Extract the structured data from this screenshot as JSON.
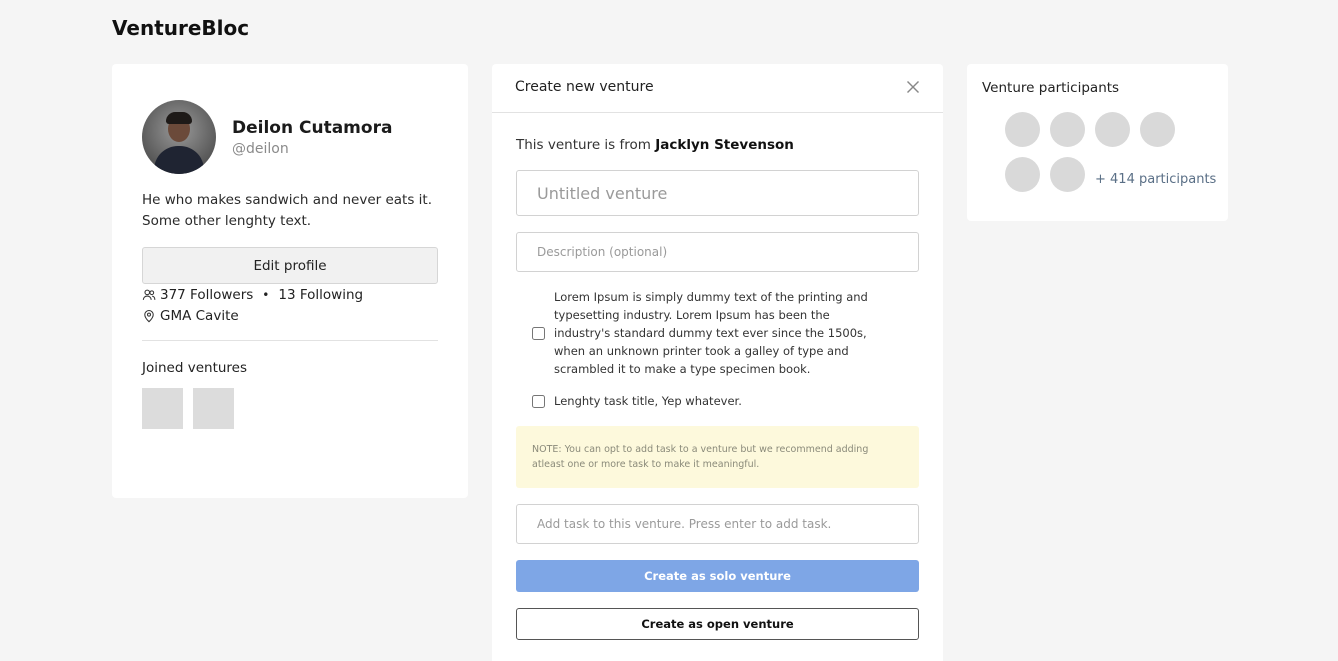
{
  "app": {
    "brand": "VentureBloc"
  },
  "profile": {
    "name": "Deilon Cutamora",
    "handle": "@deilon",
    "bio": "He who makes sandwich and never eats it. Some other lenghty text.",
    "edit_label": "Edit profile",
    "followers": "377 Followers",
    "separator": "•",
    "following": "13 Following",
    "location": "GMA Cavite",
    "joined_title": "Joined ventures",
    "joined_count": 2
  },
  "create": {
    "title": "Create new venture",
    "from_prefix": "This venture is from",
    "from_name": "Jacklyn Stevenson",
    "title_placeholder": "Untitled venture",
    "description_placeholder": "Description (optional)",
    "tasks": [
      {
        "label": "Lorem Ipsum is simply dummy text of the printing and typesetting industry. Lorem Ipsum has been the industry's standard dummy text ever since the 1500s, when an unknown printer took a galley of type and scrambled it to make a type specimen book.",
        "checked": false
      },
      {
        "label": "Lenghty task title, Yep whatever.",
        "checked": false
      }
    ],
    "note": "NOTE: You can opt to add task to a venture but we recommend adding atleast one or more task to make it meaningful.",
    "task_placeholder": "Add task to this venture. Press enter to add task.",
    "solo_label": "Create as solo venture",
    "open_label": "Create as open venture",
    "colors": {
      "solo_button": "#7ea6e6",
      "note_bg": "#fdf9dc"
    }
  },
  "participants": {
    "title": "Venture participants",
    "more": "+ 414 participants",
    "shown_avatars": 6
  },
  "icons": {
    "close": "close-icon",
    "followers": "users-icon",
    "location": "map-pin-icon"
  }
}
